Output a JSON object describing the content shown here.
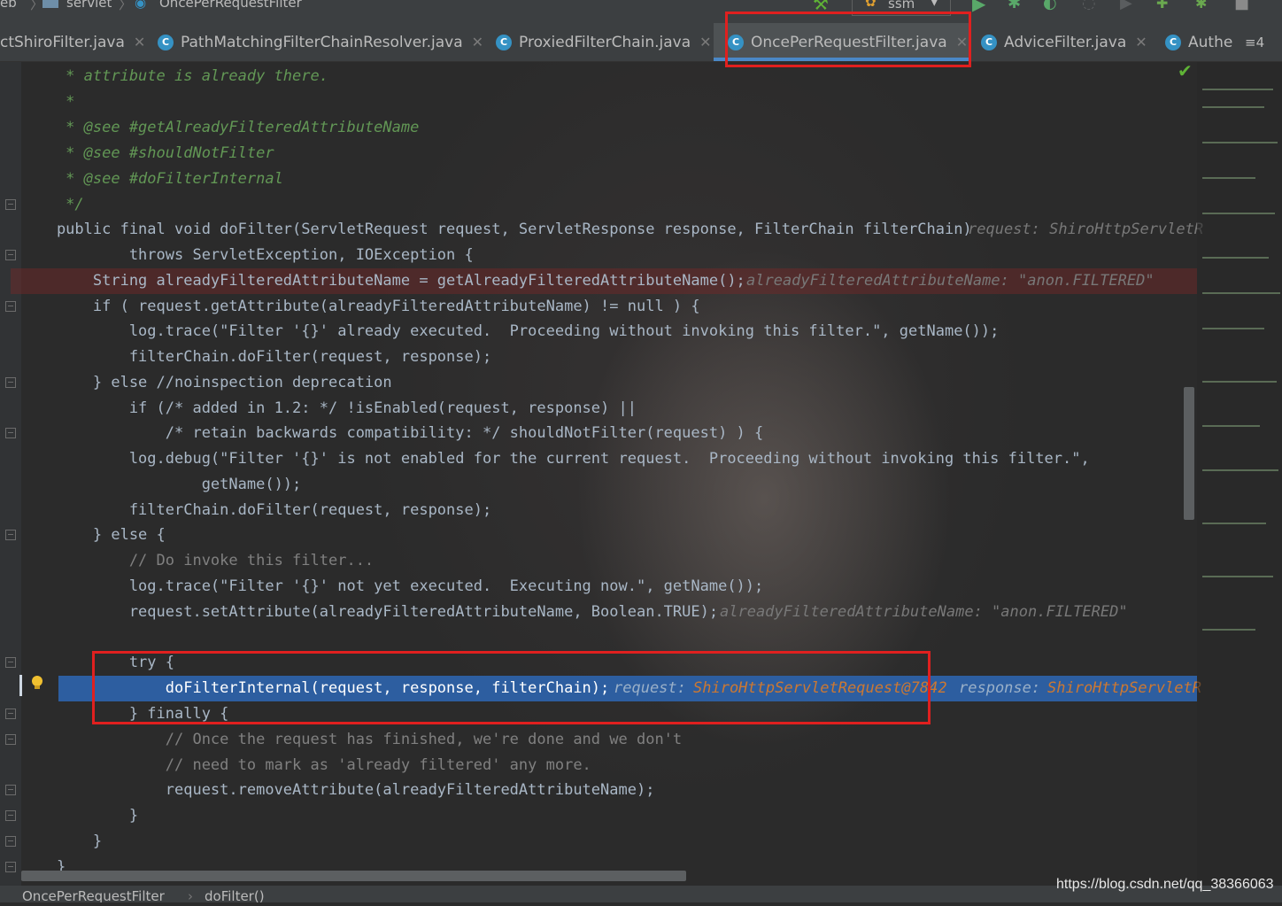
{
  "breadcrumb": {
    "items": [
      "eb",
      "servlet",
      "OncePerRequestFilter"
    ],
    "run_config": "ssm"
  },
  "tabs": [
    {
      "label": "ctShiroFilter.java"
    },
    {
      "label": "PathMatchingFilterChainResolver.java"
    },
    {
      "label": "ProxiedFilterChain.java"
    },
    {
      "label": "OncePerRequestFilter.java",
      "active": true
    },
    {
      "label": "AdviceFilter.java"
    },
    {
      "label": "Authe"
    }
  ],
  "tab_overflow": "≡4",
  "code_lines": [
    "     * attribute is already there.",
    "     *",
    "     * @see #getAlreadyFilteredAttributeName",
    "     * @see #shouldNotFilter",
    "     * @see #doFilterInternal",
    "     */",
    "    public final void doFilter(ServletRequest request, ServletResponse response, FilterChain filterChain)",
    "            throws ServletException, IOException {",
    "        String alreadyFilteredAttributeName = getAlreadyFilteredAttributeName();",
    "        if ( request.getAttribute(alreadyFilteredAttributeName) != null ) {",
    "            log.trace(\"Filter '{}' already executed.  Proceeding without invoking this filter.\", getName());",
    "            filterChain.doFilter(request, response);",
    "        } else //noinspection deprecation",
    "            if (/* added in 1.2: */ !isEnabled(request, response) ||",
    "                /* retain backwards compatibility: */ shouldNotFilter(request) ) {",
    "            log.debug(\"Filter '{}' is not enabled for the current request.  Proceeding without invoking this filter.\",",
    "                    getName());",
    "            filterChain.doFilter(request, response);",
    "        } else {",
    "            // Do invoke this filter...",
    "            log.trace(\"Filter '{}' not yet executed.  Executing now.\", getName());",
    "            request.setAttribute(alreadyFilteredAttributeName, Boolean.TRUE);",
    "",
    "            try {",
    "                doFilterInternal(request, response, filterChain);",
    "            } finally {",
    "                // Once the request has finished, we're done and we don't",
    "                // need to mark as 'already filtered' any more.",
    "                request.removeAttribute(alreadyFilteredAttributeName);",
    "            }",
    "        }",
    "    }"
  ],
  "inline_hints": {
    "line7": "request: ShiroHttpServletR",
    "line9": "alreadyFilteredAttributeName: \"anon.FILTERED\"",
    "line22": "alreadyFilteredAttributeName: \"anon.FILTERED\"",
    "line25_label1": "request:",
    "line25_val1": "ShiroHttpServletRequest@7842",
    "line25_label2": "response:",
    "line25_val2": "ShiroHttpServletR"
  },
  "status_breadcrumb": [
    "OncePerRequestFilter",
    "doFilter()"
  ],
  "watermark": "https://blog.csdn.net/qq_38366063"
}
